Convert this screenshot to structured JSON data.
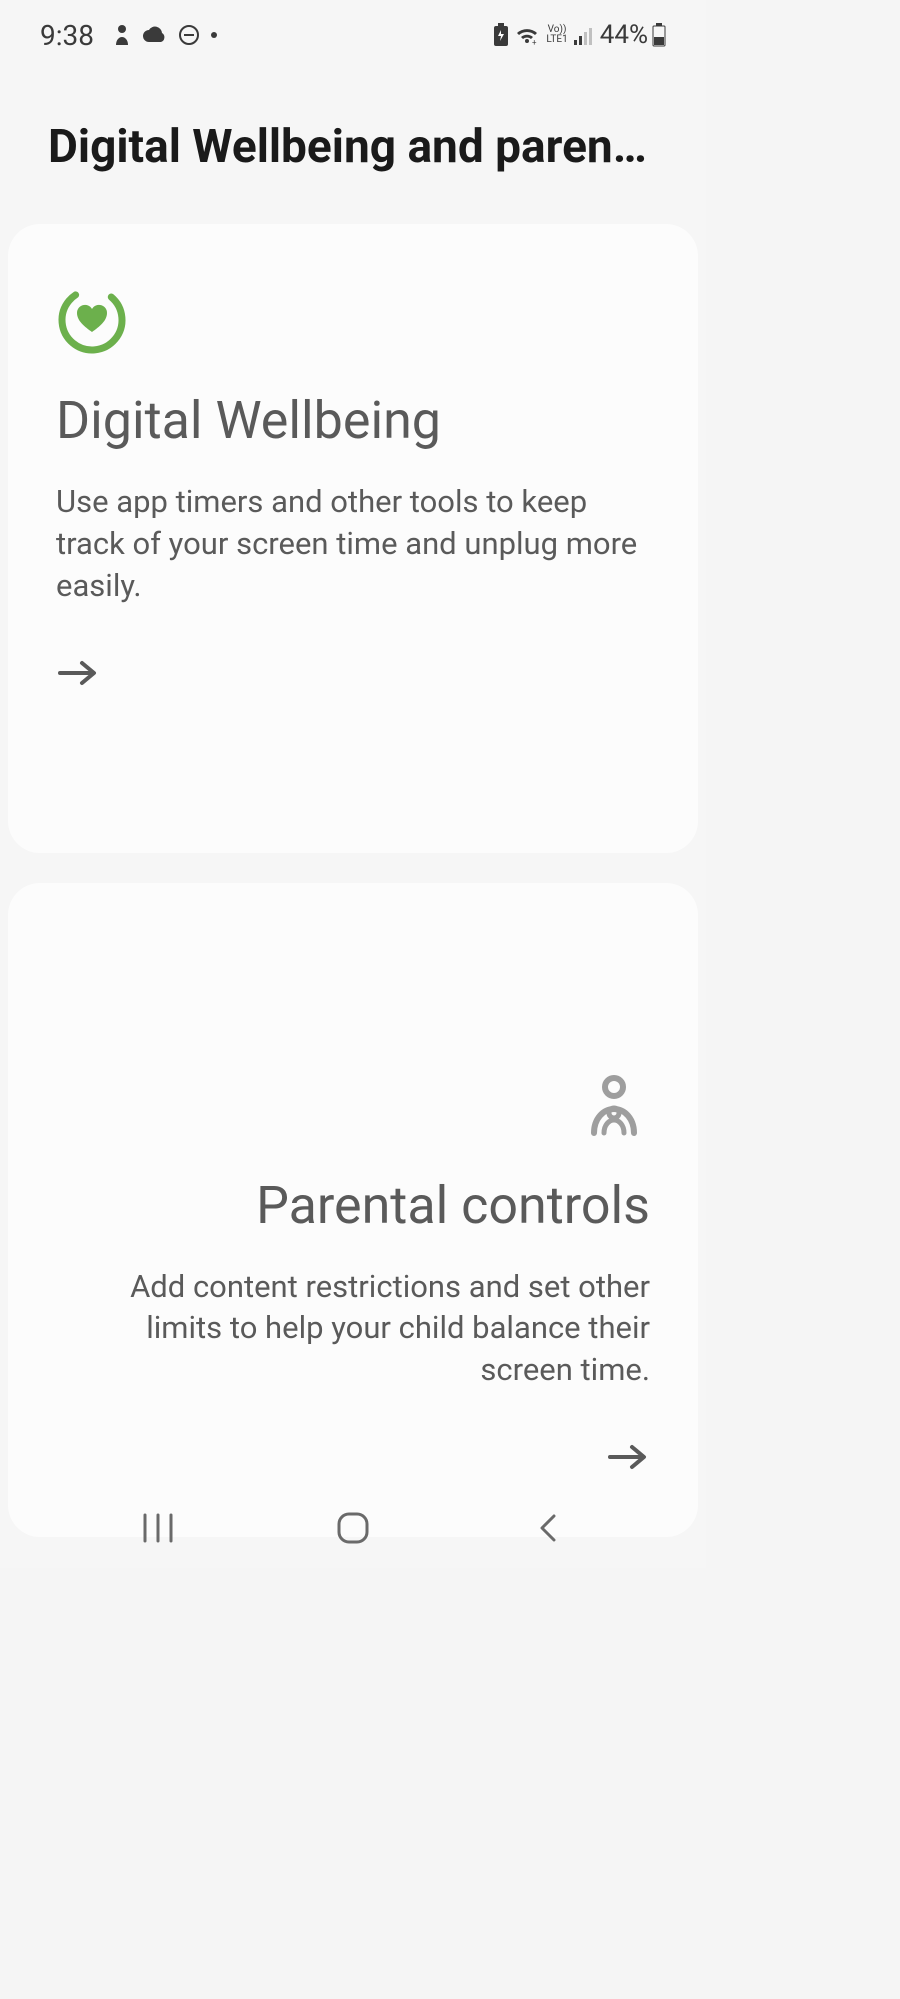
{
  "status": {
    "time": "9:38",
    "battery_pct": "44%",
    "volte_label": "Vo))",
    "lte_label": "LTE1"
  },
  "page": {
    "title": "Digital Wellbeing and parental c…"
  },
  "cards": {
    "wellbeing": {
      "title": "Digital Wellbeing",
      "description": "Use app timers and other tools to keep track of your screen time and unplug more easily."
    },
    "parental": {
      "title": "Parental controls",
      "description": "Add content restrictions and set other limits to help your child balance their screen time."
    }
  },
  "colors": {
    "accent_green": "#6cb04c",
    "text_primary": "#1a1a1a",
    "text_secondary": "#5a5a5a",
    "icon_grey": "#9e9e9e"
  }
}
